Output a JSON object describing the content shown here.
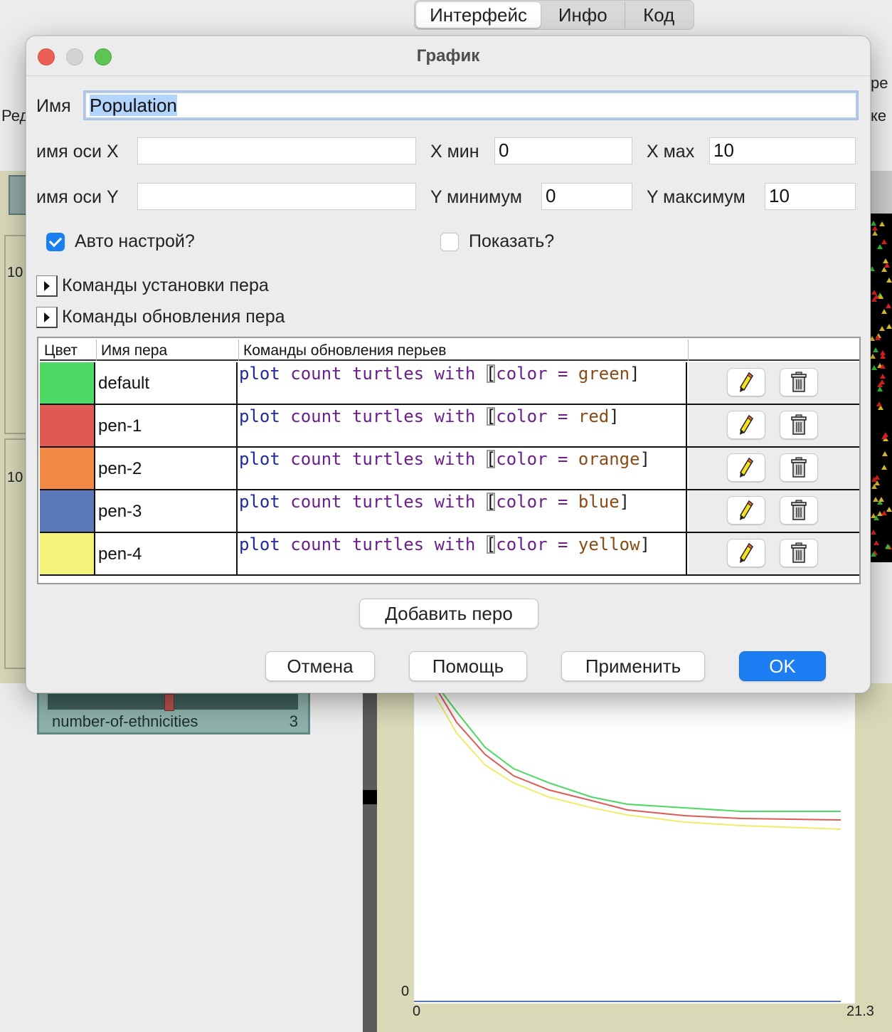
{
  "app": {
    "tabs": [
      {
        "label": "Интерфейс"
      },
      {
        "label": "Инфо"
      },
      {
        "label": "Код"
      }
    ],
    "bg_fragments": [
      "Ред",
      "ре",
      "ке",
      "10",
      "10"
    ],
    "slider": {
      "label": "number-of-ethnicities",
      "value": "3"
    },
    "plot": {
      "y_min_label": "0",
      "x_min_label": "0",
      "x_max_label": "21.3"
    }
  },
  "dialog": {
    "title": "График",
    "name_label": "Имя",
    "name_value": "Population",
    "x_axis_label": "имя оси X",
    "x_axis_value": "",
    "x_min_label": "X мин",
    "x_min_value": "0",
    "x_max_label": "X мах",
    "x_max_value": "10",
    "y_axis_label": "имя оси Y",
    "y_axis_value": "",
    "y_min_label": "Y минимум",
    "y_min_value": "0",
    "y_max_label": "Y максимум",
    "y_max_value": "10",
    "autoscale_label": "Авто настрой?",
    "autoscale_checked": true,
    "show_legend_label": "Показать?",
    "show_legend_checked": false,
    "setup_commands_label": "Команды установки пера",
    "update_commands_label": "Команды обновления пера",
    "table": {
      "headers": [
        "Цвет",
        "Имя пера",
        "Команды обновления перьев",
        ""
      ],
      "pens": [
        {
          "name": "default",
          "color": "#4cd964",
          "code": {
            "p1": "plot",
            "p2": "count",
            "p3": "turtles",
            "p4": "with",
            "br": "[",
            "var": "color",
            "op": "=",
            "val": "green",
            "end": "]"
          }
        },
        {
          "name": "pen-1",
          "color": "#e05a55",
          "code": {
            "p1": "plot",
            "p2": "count",
            "p3": "turtles",
            "p4": "with",
            "br": "[",
            "var": "color",
            "op": "=",
            "val": "red",
            "end": "]"
          }
        },
        {
          "name": "pen-2",
          "color": "#f18a45",
          "code": {
            "p1": "plot",
            "p2": "count",
            "p3": "turtles",
            "p4": "with",
            "br": "[",
            "var": "color",
            "op": "=",
            "val": "orange",
            "end": "]"
          }
        },
        {
          "name": "pen-3",
          "color": "#5b78b8",
          "code": {
            "p1": "plot",
            "p2": "count",
            "p3": "turtles",
            "p4": "with",
            "br": "[",
            "var": "color",
            "op": "=",
            "val": "blue",
            "end": "]"
          }
        },
        {
          "name": "pen-4",
          "color": "#f5f27a",
          "code": {
            "p1": "plot",
            "p2": "count",
            "p3": "turtles",
            "p4": "with",
            "br": "[",
            "var": "color",
            "op": "=",
            "val": "yellow",
            "end": "]"
          }
        }
      ]
    },
    "add_pen_label": "Добавить перо",
    "cancel_label": "Отмена",
    "help_label": "Помощь",
    "apply_label": "Применить",
    "ok_label": "OK"
  }
}
